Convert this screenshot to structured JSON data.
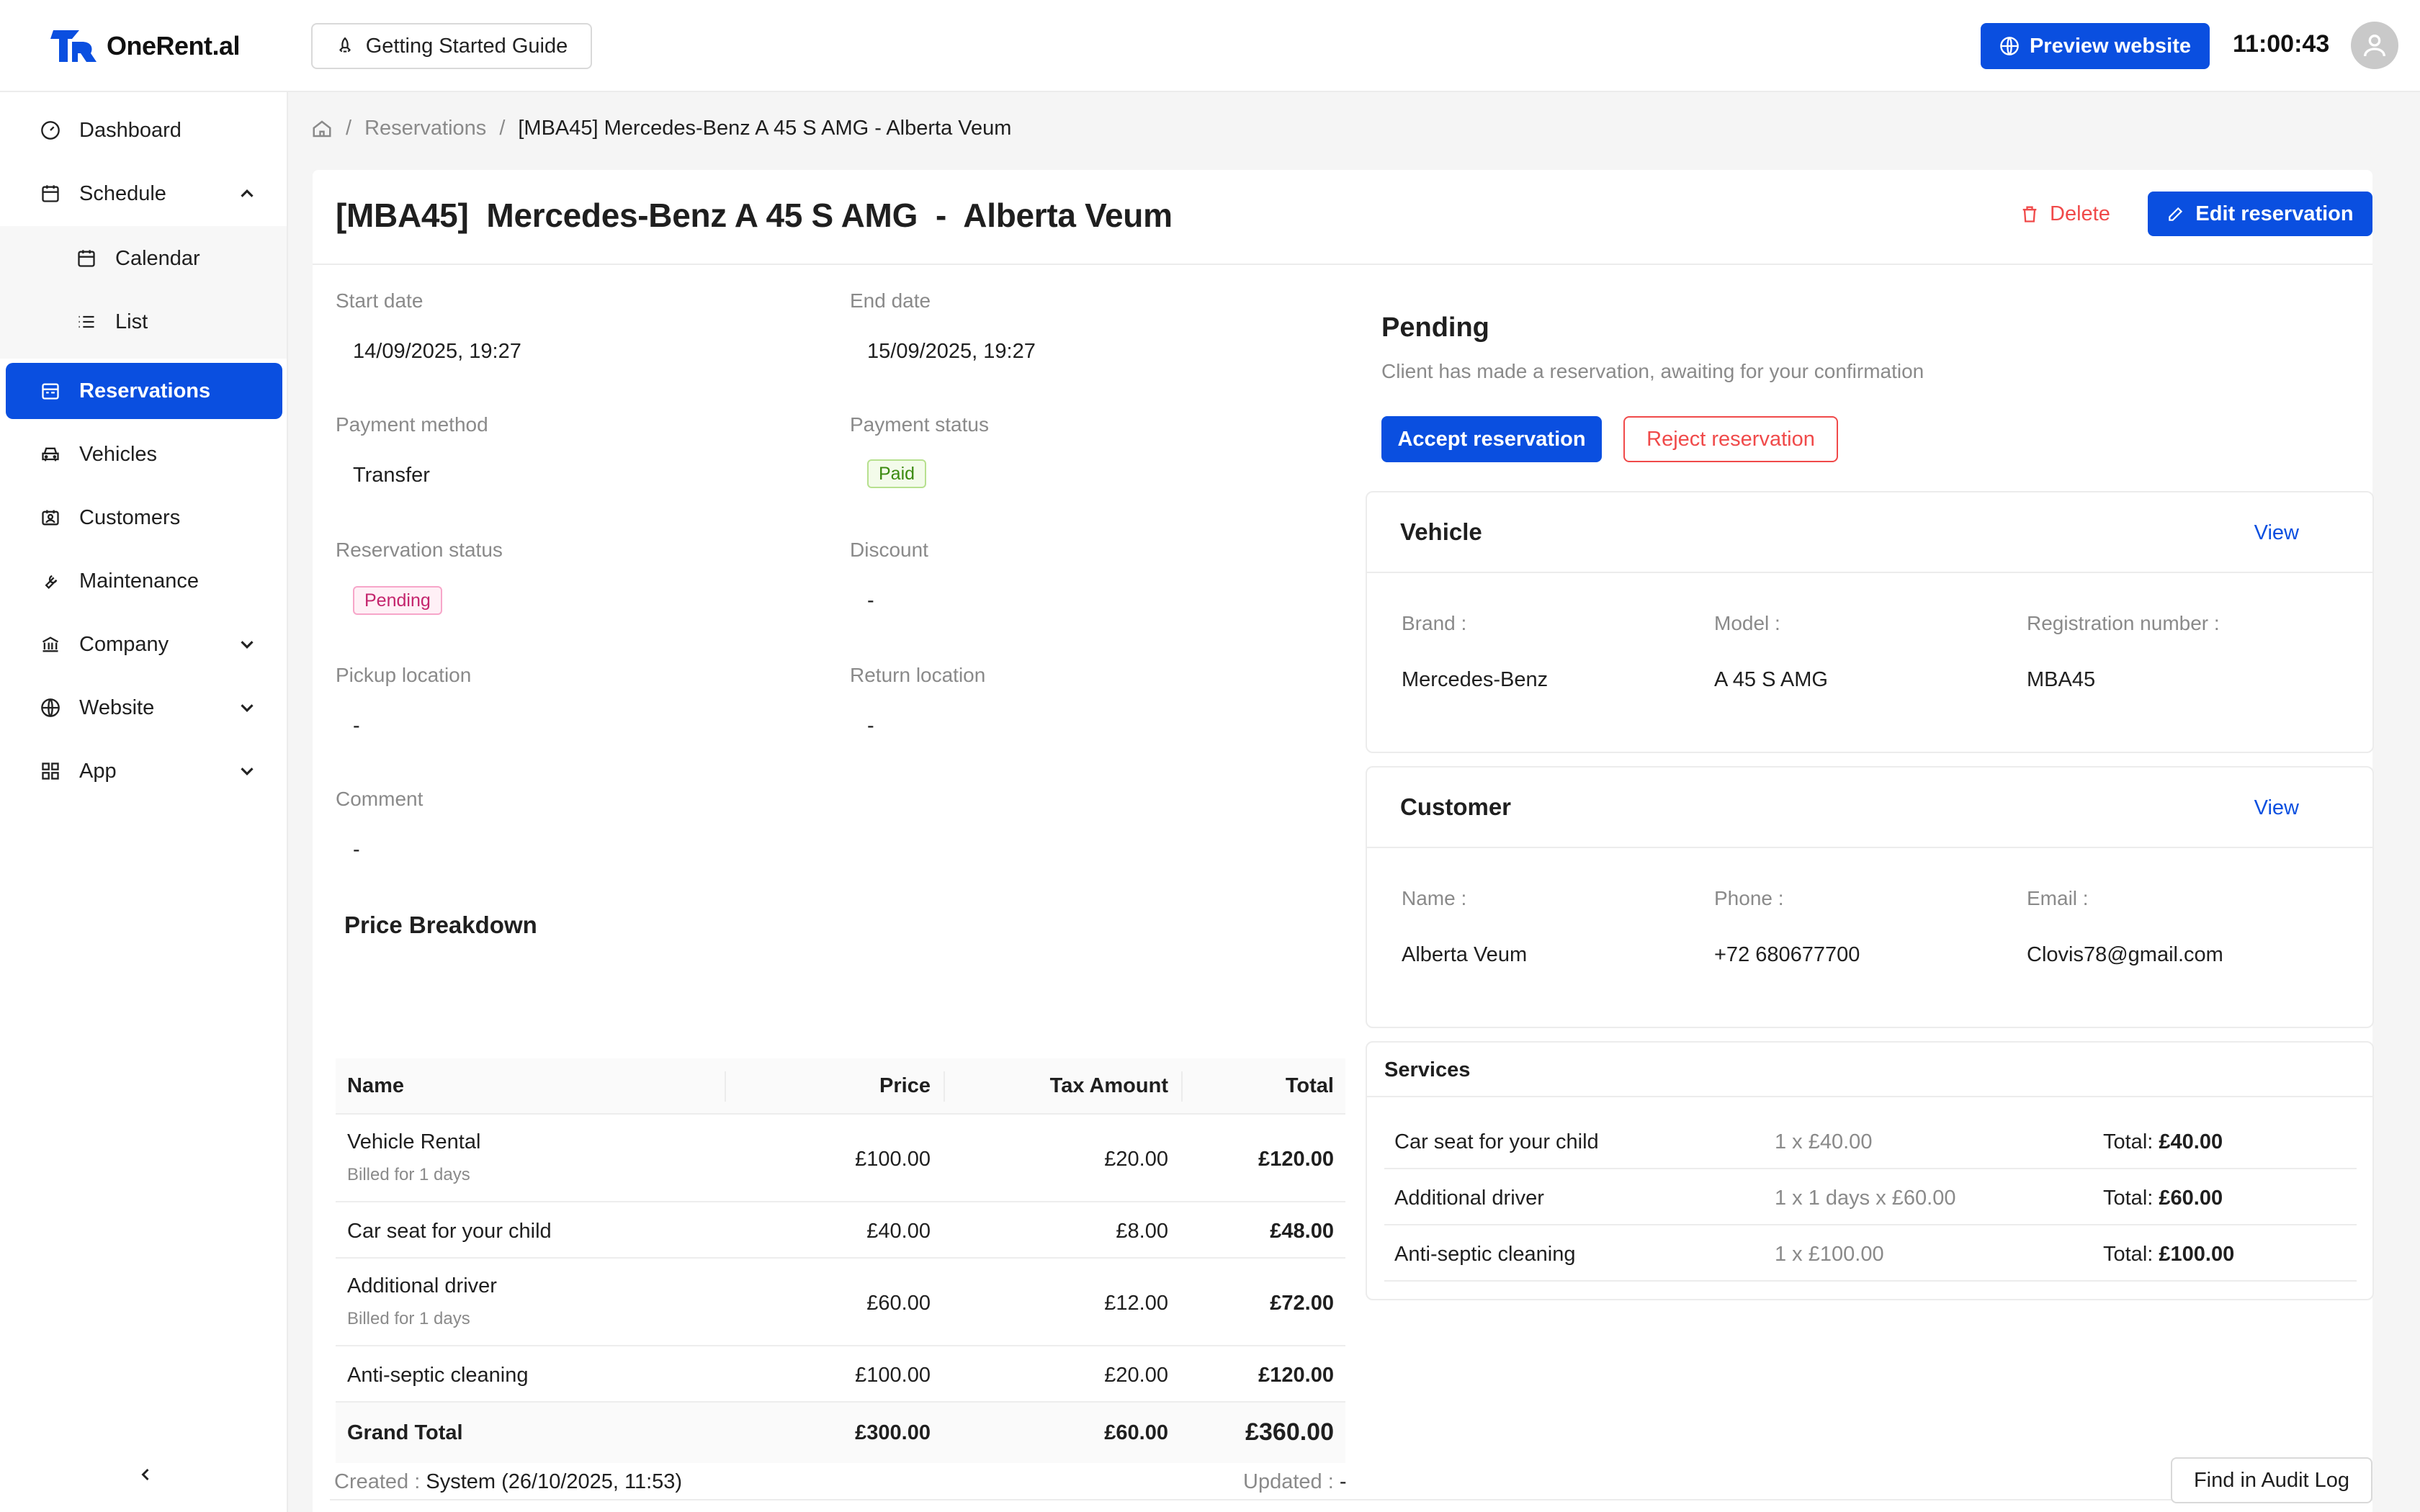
{
  "app": {
    "name": "OneRent.al",
    "clock": "11:00:43"
  },
  "header": {
    "guide_label": "Getting Started Guide",
    "preview_label": "Preview website"
  },
  "sidebar": {
    "items": [
      {
        "label": "Dashboard",
        "icon": "dashboard-icon"
      },
      {
        "label": "Schedule",
        "icon": "calendar-clock-icon"
      },
      {
        "label": "Calendar",
        "icon": "calendar-icon"
      },
      {
        "label": "List",
        "icon": "list-icon"
      },
      {
        "label": "Reservations",
        "icon": "reservations-icon"
      },
      {
        "label": "Vehicles",
        "icon": "car-icon"
      },
      {
        "label": "Customers",
        "icon": "id-card-icon"
      },
      {
        "label": "Maintenance",
        "icon": "wrench-icon"
      },
      {
        "label": "Company",
        "icon": "bank-icon"
      },
      {
        "label": "Website",
        "icon": "globe-icon"
      },
      {
        "label": "App",
        "icon": "grid-icon"
      }
    ]
  },
  "breadcrumb": {
    "parent": "Reservations",
    "current": "[MBA45] Mercedes-Benz A 45 S AMG - Alberta Veum"
  },
  "page": {
    "title": "[MBA45]  Mercedes-Benz A 45 S AMG  -  Alberta Veum",
    "delete_label": "Delete",
    "edit_label": "Edit reservation"
  },
  "details": {
    "start_date_label": "Start date",
    "start_date": "14/09/2025, 19:27",
    "end_date_label": "End date",
    "end_date": "15/09/2025, 19:27",
    "payment_method_label": "Payment method",
    "payment_method": "Transfer",
    "payment_status_label": "Payment status",
    "payment_status": "Paid",
    "reservation_status_label": "Reservation status",
    "reservation_status": "Pending",
    "discount_label": "Discount",
    "discount": "-",
    "pickup_label": "Pickup location",
    "pickup": "-",
    "return_label": "Return location",
    "return": "-",
    "comment_label": "Comment",
    "comment": "-"
  },
  "price": {
    "title": "Price Breakdown",
    "headers": {
      "name": "Name",
      "price": "Price",
      "tax": "Tax Amount",
      "total": "Total"
    },
    "rows": [
      {
        "name": "Vehicle Rental",
        "sub": "Billed for 1 days",
        "price": "£100.00",
        "tax": "£20.00",
        "total": "£120.00"
      },
      {
        "name": "Car seat for your child",
        "sub": "",
        "price": "£40.00",
        "tax": "£8.00",
        "total": "£48.00"
      },
      {
        "name": "Additional driver",
        "sub": "Billed for 1 days",
        "price": "£60.00",
        "tax": "£12.00",
        "total": "£72.00"
      },
      {
        "name": "Anti-septic cleaning",
        "sub": "",
        "price": "£100.00",
        "tax": "£20.00",
        "total": "£120.00"
      }
    ],
    "grand": {
      "name": "Grand Total",
      "price": "£300.00",
      "tax": "£60.00",
      "total": "£360.00"
    }
  },
  "status": {
    "title": "Pending",
    "description": "Client has made a reservation, awaiting for your confirmation",
    "accept_label": "Accept reservation",
    "reject_label": "Reject reservation"
  },
  "vehicle": {
    "title": "Vehicle",
    "view_label": "View",
    "brand_label": "Brand :",
    "brand": "Mercedes-Benz",
    "model_label": "Model :",
    "model": "A 45 S AMG",
    "reg_label": "Registration number :",
    "reg": "MBA45"
  },
  "customer": {
    "title": "Customer",
    "view_label": "View",
    "name_label": "Name :",
    "name": "Alberta Veum",
    "phone_label": "Phone :",
    "phone": "+72 680677700",
    "email_label": "Email :",
    "email": "Clovis78@gmail.com"
  },
  "services": {
    "title": "Services",
    "total_prefix": "Total: ",
    "rows": [
      {
        "name": "Car seat for your child",
        "qty": "1 x £40.00",
        "total": "£40.00"
      },
      {
        "name": "Additional driver",
        "qty": "1 x 1 days x £60.00",
        "total": "£60.00"
      },
      {
        "name": "Anti-septic cleaning",
        "qty": "1 x £100.00",
        "total": "£100.00"
      }
    ]
  },
  "footer": {
    "created_label": "Created :",
    "created": "System (26/10/2025, 11:53)",
    "updated_label": "Updated :",
    "updated": "-",
    "audit_label": "Find in Audit Log"
  },
  "colors": {
    "accent": "#0a4fe0",
    "danger": "#f04a4a",
    "paid": "#3b8a10",
    "pending": "#c4256d"
  }
}
